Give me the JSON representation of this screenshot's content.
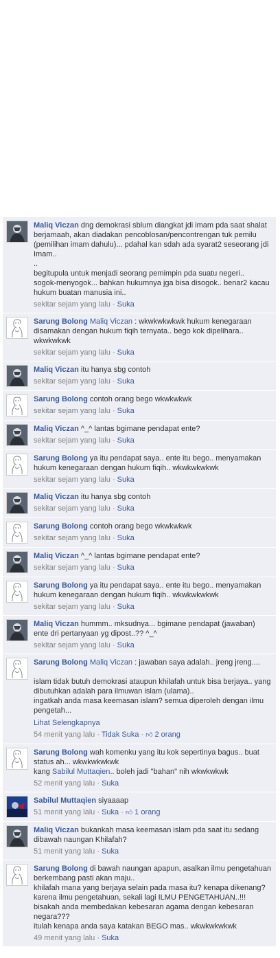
{
  "ui": {
    "like": "Suka",
    "unlike": "Tidak Suka",
    "see_more": "Lihat Selengkapnya",
    "dot": " · "
  },
  "comments": [
    {
      "author": "Maliq Viczan",
      "avatar": "maliq",
      "text": "dng demokrasi sblum diangkat jdi imam pda saat shalat berjamaah, akan diadakan pencoblosan/pencontrengan tuk pemilu (pemilihan imam dahulu)... pdahal kan sdah ada syarat2 seseorang jdi Imam..\n..\nbegitupula untuk menjadi seorang pemimpin pda suatu negeri..\nsogok-menyogok... bahkan hukumnya jga bisa disogok.. benar2 kacau hukum buatan manusia ini..",
      "time": "sekitar sejam yang lalu"
    },
    {
      "author": "Sarung Bolong",
      "avatar": "sarung",
      "mention": "Maliq Viczan",
      "text": " : wkwkwkwkwk hukum kenegaraan disamakan dengan hukum fiqih ternyata.. bego kok dipelihara.. wkwkwkwk",
      "time": "sekitar sejam yang lalu"
    },
    {
      "author": "Maliq Viczan",
      "avatar": "maliq",
      "text": "itu hanya sbg contoh",
      "time": "sekitar sejam yang lalu"
    },
    {
      "author": "Sarung Bolong",
      "avatar": "sarung",
      "text": "contoh orang bego wkwkwkwk",
      "time": "sekitar sejam yang lalu"
    },
    {
      "author": "Maliq Viczan",
      "avatar": "maliq",
      "text": "^_^ lantas bgimane pendapat ente?",
      "time": "sekitar sejam yang lalu"
    },
    {
      "author": "Sarung Bolong",
      "avatar": "sarung",
      "text": "ya itu pendapat saya.. ente itu bego.. menyamakan hukum kenegaraan dengan hukum fiqih.. wkwkwkwkwk",
      "time": "sekitar sejam yang lalu"
    },
    {
      "author": "Maliq Viczan",
      "avatar": "maliq",
      "text": "itu hanya sbg contoh",
      "time": "sekitar sejam yang lalu"
    },
    {
      "author": "Sarung Bolong",
      "avatar": "sarung",
      "text": "contoh orang bego wkwkwkwk",
      "time": "sekitar sejam yang lalu"
    },
    {
      "author": "Maliq Viczan",
      "avatar": "maliq",
      "text": "^_^ lantas bgimane pendapat ente?",
      "time": "sekitar sejam yang lalu"
    },
    {
      "author": "Sarung Bolong",
      "avatar": "sarung",
      "text": "ya itu pendapat saya.. ente itu bego.. menyamakan hukum kenegaraan dengan hukum fiqih.. wkwkwkwkwk",
      "time": "sekitar sejam yang lalu"
    },
    {
      "author": "Maliq Viczan",
      "avatar": "maliq",
      "text": "hummm.. mksudnya... bgimane pendapat (jawaban) ente dri pertanyaan yg dipost..?? ^_^",
      "time": "sekitar sejam yang lalu"
    },
    {
      "author": "Sarung Bolong",
      "avatar": "sarung",
      "mention": "Maliq Viczan",
      "text": " : jawaban saya adalah.. jreng jreng....\n\nislam tidak butuh demokrasi ataupun khilafah untuk bisa berjaya.. yang dibutuhkan adalah para ilmuwan islam (ulama)..\ningatkah anda masa keemasan islam? semua diperoleh dengan ilmu pengetah...",
      "see_more": true,
      "time": "54 menit yang lalu",
      "unlike": true,
      "likes": "2 orang"
    },
    {
      "author": "Sarung Bolong",
      "avatar": "sarung",
      "text": "wah komenku yang itu kok sepertinya bagus.. buat status ah... wkwkwkwkwk\nkang ",
      "mention2": "Sabilul Muttaqien",
      "text2": ".. boleh jadi \"bahan\" nih wkwkwkwk",
      "time": "52 menit yang lalu"
    },
    {
      "author": "Sabilul Muttaqien",
      "avatar": "sabilul",
      "text": "siyaaaap",
      "time": "51 menit yang lalu",
      "likes": "1 orang"
    },
    {
      "author": "Maliq Viczan",
      "avatar": "maliq",
      "text": "bukankah masa keemasan islam pda saat itu sedang dibawah naungan Khilafah?",
      "time": "51 menit yang lalu"
    },
    {
      "author": "Sarung Bolong",
      "avatar": "sarung",
      "text": "di bawah naungan apapun, asalkan ilmu pengetahuan berkembang pasti akan maju..\nkhilafah mana yang berjaya selain pada masa itu? kenapa dikenang? karena ilmu pengetahuan, sekali lagi ILMU PENGETAHUAN..!!!\nbisakah anda membedakan kebesaran agama dengan kebesaran negara???\nitulah kenapa anda saya katakan BEGO mas.. wkwkwkwkwk",
      "time": "49 menit yang lalu"
    }
  ]
}
